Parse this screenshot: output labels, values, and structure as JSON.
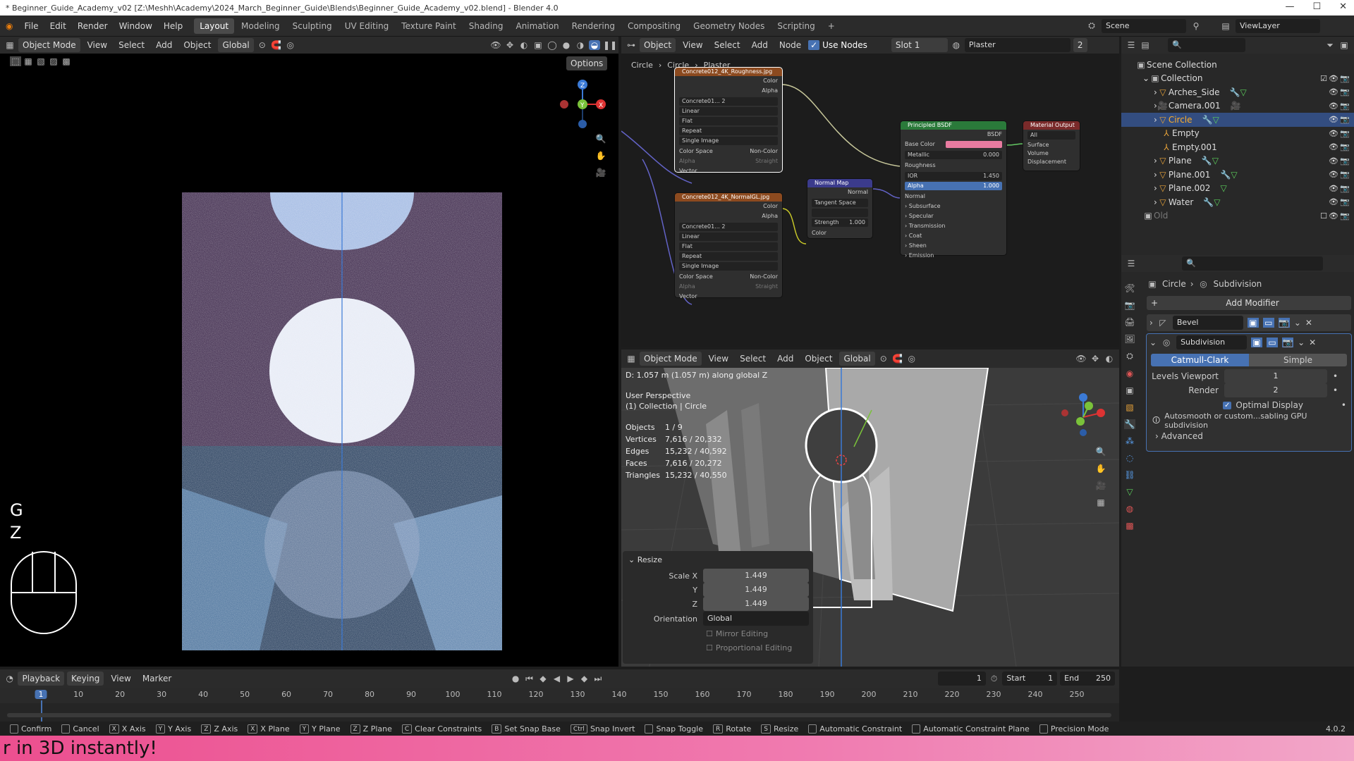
{
  "window": {
    "title": "* Beginner_Guide_Academy_v02 [Z:\\Meshh\\Academy\\2024_March_Beginner_Guide\\Blends\\Beginner_Guide_Academy_v02.blend] - Blender 4.0"
  },
  "menu": [
    "File",
    "Edit",
    "Render",
    "Window",
    "Help"
  ],
  "workspaces": [
    "Layout",
    "Modeling",
    "Sculpting",
    "UV Editing",
    "Texture Paint",
    "Shading",
    "Animation",
    "Rendering",
    "Compositing",
    "Geometry Nodes",
    "Scripting"
  ],
  "scene": {
    "name": "Scene",
    "view_layer": "ViewLayer"
  },
  "viewport_left": {
    "mode": "Object Mode",
    "menus": [
      "View",
      "Select",
      "Add",
      "Object"
    ],
    "orientation": "Global",
    "options": "Options",
    "keys": [
      "G",
      "Z"
    ]
  },
  "node_editor": {
    "editor": "Object",
    "menus": [
      "View",
      "Select",
      "Add",
      "Node"
    ],
    "use_nodes": "Use Nodes",
    "slot": "Slot 1",
    "material": "Plaster",
    "users": "2",
    "breadcrumb": [
      "Circle",
      "Circle",
      "Plaster"
    ],
    "tex1": {
      "title": "Concrete012_4K_Roughness.jpg",
      "img": "Concrete01...",
      "users": "2",
      "interp": "Linear",
      "proj": "Flat",
      "ext": "Repeat",
      "src": "Single Image",
      "cs_label": "Color Space",
      "cs": "Non-Color",
      "alpha_label": "Alpha",
      "alpha": "Straight",
      "out_color": "Color",
      "out_alpha": "Alpha",
      "vector": "Vector"
    },
    "tex2": {
      "title": "Concrete012_4K_NormalGL.jpg",
      "img": "Concrete01...",
      "users": "2",
      "interp": "Linear",
      "proj": "Flat",
      "ext": "Repeat",
      "src": "Single Image",
      "cs_label": "Color Space",
      "cs": "Non-Color",
      "alpha_label": "Alpha",
      "alpha": "Straight",
      "out_color": "Color",
      "out_alpha": "Alpha",
      "vector": "Vector"
    },
    "normal_map": {
      "title": "Normal Map",
      "out": "Normal",
      "space": "Tangent Space",
      "strength_label": "Strength",
      "strength": "1.000",
      "color": "Color"
    },
    "bsdf": {
      "title": "Principled BSDF",
      "out": "BSDF",
      "rows": [
        {
          "l": "Base Color",
          "v": ""
        },
        {
          "l": "Metallic",
          "v": "0.000"
        },
        {
          "l": "Roughness",
          "v": ""
        },
        {
          "l": "IOR",
          "v": "1.450"
        },
        {
          "l": "Alpha",
          "v": "1.000"
        },
        {
          "l": "Normal",
          "v": ""
        }
      ],
      "panels": [
        "Subsurface",
        "Specular",
        "Transmission",
        "Coat",
        "Sheen",
        "Emission"
      ]
    },
    "output": {
      "title": "Material Output",
      "target": "All",
      "sockets": [
        "Surface",
        "Volume",
        "Displacement"
      ]
    }
  },
  "viewport_right": {
    "mode": "Object Mode",
    "menus": [
      "View",
      "Select",
      "Add",
      "Object"
    ],
    "orientation": "Global",
    "header_info": "D: 1.057 m (1.057 m) along global Z",
    "perspective": "User Perspective",
    "collection": "(1) Collection | Circle",
    "stats": [
      {
        "l": "Objects",
        "v": "1 / 9"
      },
      {
        "l": "Vertices",
        "v": "7,616 / 20,332"
      },
      {
        "l": "Edges",
        "v": "15,232 / 40,592"
      },
      {
        "l": "Faces",
        "v": "7,616 / 20,272"
      },
      {
        "l": "Triangles",
        "v": "15,232 / 40,550"
      }
    ],
    "op_panel": {
      "title": "Resize",
      "scale_x_label": "Scale X",
      "y_label": "Y",
      "z_label": "Z",
      "x": "1.449",
      "y": "1.449",
      "z": "1.449",
      "orient_label": "Orientation",
      "orient": "Global",
      "mirror": "Mirror Editing",
      "prop": "Proportional Editing"
    }
  },
  "outliner": {
    "root": "Scene Collection",
    "collection": "Collection",
    "items": [
      {
        "name": "Arches_Side"
      },
      {
        "name": "Camera.001"
      },
      {
        "name": "Circle"
      },
      {
        "name": "Empty"
      },
      {
        "name": "Empty.001"
      },
      {
        "name": "Plane"
      },
      {
        "name": "Plane.001"
      },
      {
        "name": "Plane.002"
      },
      {
        "name": "Water"
      }
    ],
    "old": "Old"
  },
  "properties": {
    "breadcrumb_obj": "Circle",
    "breadcrumb_mod": "Subdivision",
    "add_modifier": "Add Modifier",
    "bevel": "Bevel",
    "subdivision": "Subdivision",
    "catmull": "Catmull-Clark",
    "simple": "Simple",
    "levels_label": "Levels Viewport",
    "levels": "1",
    "render_label": "Render",
    "render": "2",
    "optimal": "Optimal Display",
    "warning": "Autosmooth or custom...sabling GPU subdivision",
    "advanced": "Advanced"
  },
  "timeline": {
    "menus": [
      "Playback",
      "Keying",
      "View",
      "Marker"
    ],
    "current": "1",
    "start_label": "Start",
    "start": "1",
    "end_label": "End",
    "end": "250",
    "ticks": [
      "1",
      "10",
      "20",
      "30",
      "40",
      "50",
      "60",
      "70",
      "80",
      "90",
      "100",
      "110",
      "120",
      "130",
      "140",
      "150",
      "160",
      "170",
      "180",
      "190",
      "200",
      "210",
      "220",
      "230",
      "240",
      "250"
    ]
  },
  "status": [
    {
      "k": "",
      "l": "Confirm"
    },
    {
      "k": "",
      "l": "Cancel"
    },
    {
      "k": "X",
      "l": "X Axis"
    },
    {
      "k": "Y",
      "l": "Y Axis"
    },
    {
      "k": "Z",
      "l": "Z Axis"
    },
    {
      "k": "X",
      "l": "X Plane"
    },
    {
      "k": "Y",
      "l": "Y Plane"
    },
    {
      "k": "Z",
      "l": "Z Plane"
    },
    {
      "k": "C",
      "l": "Clear Constraints"
    },
    {
      "k": "B",
      "l": "Set Snap Base"
    },
    {
      "k": "Ctrl",
      "l": "Snap Invert"
    },
    {
      "k": "",
      "l": "Snap Toggle"
    },
    {
      "k": "R",
      "l": "Rotate"
    },
    {
      "k": "S",
      "l": "Resize"
    },
    {
      "k": "",
      "l": "Automatic Constraint"
    },
    {
      "k": "",
      "l": "Automatic Constraint Plane"
    },
    {
      "k": "",
      "l": "Precision Mode"
    }
  ],
  "version": "4.0.2",
  "banner": "r in 3D instantly!"
}
